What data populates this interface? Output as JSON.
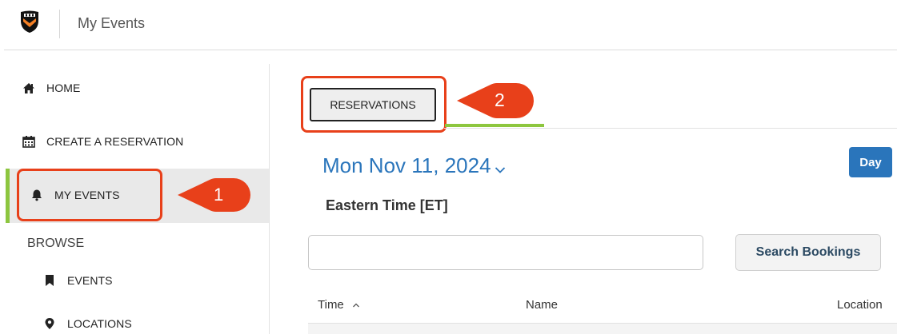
{
  "header": {
    "title": "My Events",
    "logo_icon": "university-shield-icon"
  },
  "sidebar": {
    "items": [
      {
        "label": "HOME",
        "icon": "home-icon"
      },
      {
        "label": "CREATE A RESERVATION",
        "icon": "calendar-icon"
      },
      {
        "label": "MY EVENTS",
        "icon": "bell-icon",
        "active": true
      }
    ],
    "browse_heading": "BROWSE",
    "browse_items": [
      {
        "label": "EVENTS",
        "icon": "bookmark-icon"
      },
      {
        "label": "LOCATIONS",
        "icon": "map-pin-icon"
      }
    ]
  },
  "main": {
    "tab_label": "RESERVATIONS",
    "date_label": "Mon Nov 11, 2024",
    "view_button_label": "Day",
    "timezone_label": "Eastern Time [ET]",
    "search": {
      "value": "",
      "placeholder": ""
    },
    "search_button_label": "Search Bookings",
    "table_headers": {
      "time": "Time",
      "name": "Name",
      "location": "Location"
    }
  },
  "annotations": {
    "step1": "1",
    "step2": "2"
  },
  "colors": {
    "accent_blue": "#2a75bb",
    "active_green": "#8dc63f",
    "annotation_orange": "#e8401a"
  }
}
